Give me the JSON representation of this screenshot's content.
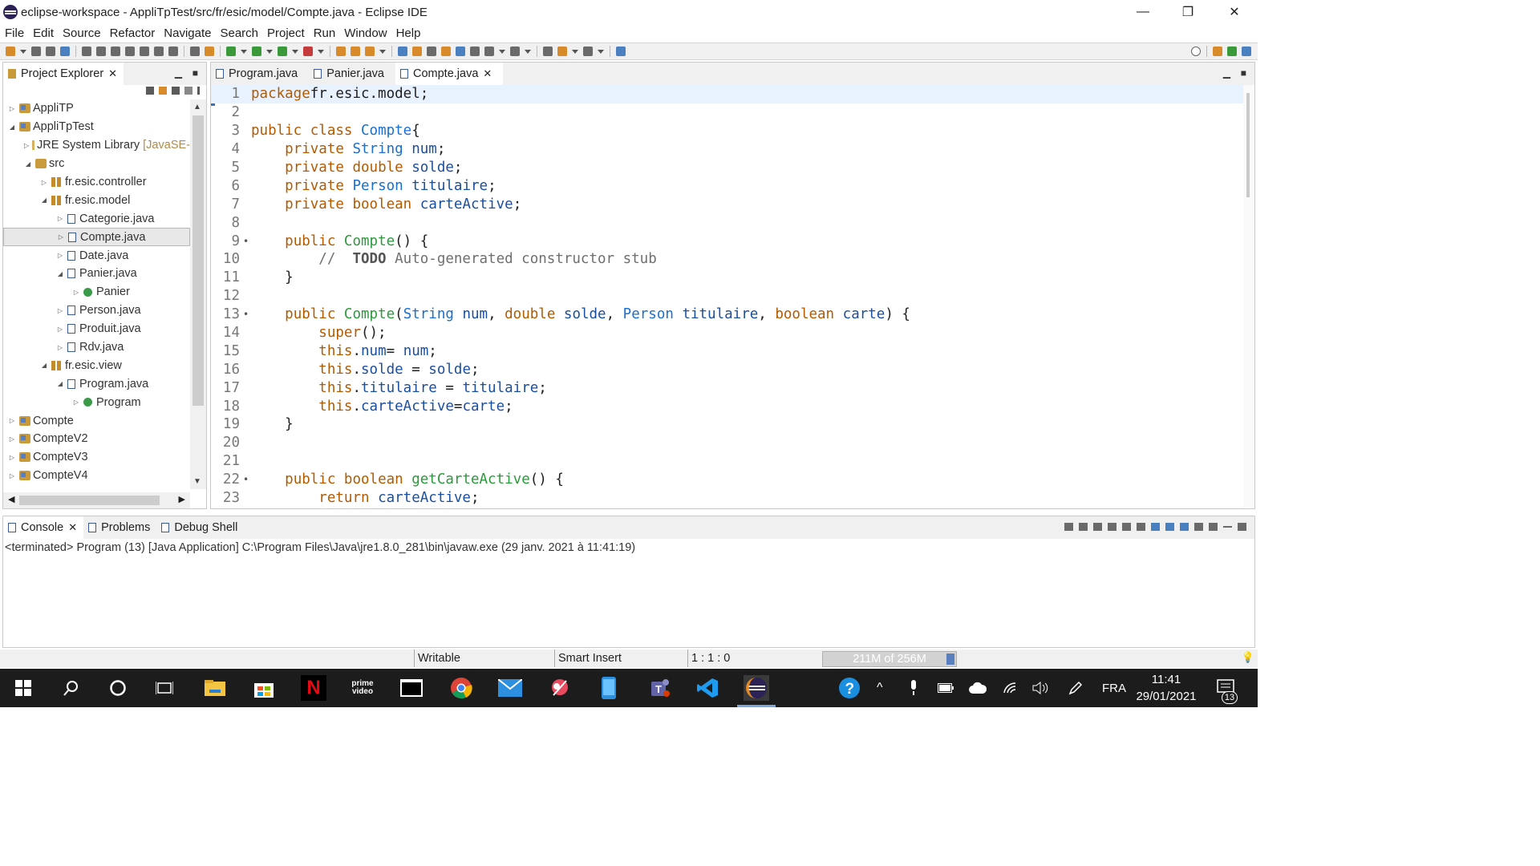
{
  "window": {
    "title": "eclipse-workspace - AppliTpTest/src/fr/esic/model/Compte.java - Eclipse IDE",
    "minimize": "—",
    "restore": "❐",
    "close": "✕"
  },
  "menu": [
    "File",
    "Edit",
    "Source",
    "Refactor",
    "Navigate",
    "Search",
    "Project",
    "Run",
    "Window",
    "Help"
  ],
  "explorer": {
    "tab_label": "Project Explorer",
    "tree": [
      {
        "label": "AppliTP",
        "icon": "project-icon",
        "indent": 0,
        "twisty": "▷"
      },
      {
        "label": "AppliTpTest",
        "icon": "project-icon",
        "indent": 0,
        "twisty": "◢"
      },
      {
        "label": "JRE System Library",
        "suffix": "[JavaSE-",
        "icon": "library-icon",
        "indent": 1,
        "twisty": "▷"
      },
      {
        "label": "src",
        "icon": "source-folder-icon",
        "indent": 1,
        "twisty": "◢"
      },
      {
        "label": "fr.esic.controller",
        "icon": "package-icon",
        "indent": 2,
        "twisty": "▷"
      },
      {
        "label": "fr.esic.model",
        "icon": "package-icon",
        "indent": 2,
        "twisty": "◢"
      },
      {
        "label": "Categorie.java",
        "icon": "java-file-icon",
        "indent": 3,
        "twisty": "▷"
      },
      {
        "label": "Compte.java",
        "icon": "java-file-icon",
        "indent": 3,
        "twisty": "▷",
        "selected": true
      },
      {
        "label": "Date.java",
        "icon": "java-file-icon",
        "indent": 3,
        "twisty": "▷"
      },
      {
        "label": "Panier.java",
        "icon": "java-file-icon",
        "indent": 3,
        "twisty": "◢"
      },
      {
        "label": "Panier",
        "icon": "class-icon",
        "indent": 4,
        "twisty": "▷"
      },
      {
        "label": "Person.java",
        "icon": "java-file-icon",
        "indent": 3,
        "twisty": "▷"
      },
      {
        "label": "Produit.java",
        "icon": "java-file-icon",
        "indent": 3,
        "twisty": "▷"
      },
      {
        "label": "Rdv.java",
        "icon": "java-file-icon",
        "indent": 3,
        "twisty": "▷"
      },
      {
        "label": "fr.esic.view",
        "icon": "package-icon",
        "indent": 2,
        "twisty": "◢"
      },
      {
        "label": "Program.java",
        "icon": "java-file-icon",
        "indent": 3,
        "twisty": "◢"
      },
      {
        "label": "Program",
        "icon": "class-icon",
        "indent": 4,
        "twisty": "▷"
      },
      {
        "label": "Compte",
        "icon": "project-icon",
        "indent": 0,
        "twisty": "▷"
      },
      {
        "label": "CompteV2",
        "icon": "project-icon",
        "indent": 0,
        "twisty": "▷"
      },
      {
        "label": "CompteV3",
        "icon": "project-icon",
        "indent": 0,
        "twisty": "▷"
      },
      {
        "label": "CompteV4",
        "icon": "project-icon",
        "indent": 0,
        "twisty": "▷"
      }
    ]
  },
  "editor": {
    "tabs": [
      {
        "label": "Program.java",
        "active": false
      },
      {
        "label": "Panier.java",
        "active": false
      },
      {
        "label": "Compte.java",
        "active": true
      }
    ],
    "lines": [
      {
        "n": "1",
        "tokens": [
          [
            "kw",
            "package"
          ],
          [
            "",
            "fr.esic.model;"
          ]
        ],
        "current": true
      },
      {
        "n": "2",
        "tokens": []
      },
      {
        "n": "3",
        "tokens": [
          [
            "kw",
            "public"
          ],
          [
            "kw",
            "class"
          ],
          [
            "ty",
            "Compte"
          ],
          [
            "",
            "{"
          ]
        ]
      },
      {
        "n": "4",
        "tokens": [
          [
            "",
            "    "
          ],
          [
            "kw",
            "private"
          ],
          [
            "ty",
            "String"
          ],
          [
            "va",
            "num"
          ],
          [
            "",
            ";"
          ]
        ]
      },
      {
        "n": "5",
        "tokens": [
          [
            "",
            "    "
          ],
          [
            "kw",
            "private"
          ],
          [
            "kw",
            "double"
          ],
          [
            "va",
            "solde"
          ],
          [
            "",
            ";"
          ]
        ]
      },
      {
        "n": "6",
        "tokens": [
          [
            "",
            "    "
          ],
          [
            "kw",
            "private"
          ],
          [
            "ty",
            "Person"
          ],
          [
            "va",
            "titulaire"
          ],
          [
            "",
            ";"
          ]
        ]
      },
      {
        "n": "7",
        "tokens": [
          [
            "",
            "    "
          ],
          [
            "kw",
            "private"
          ],
          [
            "kw",
            "boolean"
          ],
          [
            "va",
            "carteActive"
          ],
          [
            "",
            ";"
          ]
        ]
      },
      {
        "n": "8",
        "tokens": []
      },
      {
        "n": "9",
        "fold": true,
        "tokens": [
          [
            "",
            "    "
          ],
          [
            "kw",
            "public"
          ],
          [
            "fn",
            "Compte"
          ],
          [
            "",
            "() {"
          ]
        ]
      },
      {
        "n": "10",
        "task": true,
        "tokens": [
          [
            "",
            "        "
          ],
          [
            "cm",
            "// "
          ],
          [
            "td",
            "TODO"
          ],
          [
            "cm",
            " Auto-generated constructor stub"
          ]
        ]
      },
      {
        "n": "11",
        "tokens": [
          [
            "",
            "    }"
          ]
        ]
      },
      {
        "n": "12",
        "tokens": []
      },
      {
        "n": "13",
        "fold": true,
        "tokens": [
          [
            "",
            "    "
          ],
          [
            "kw",
            "public"
          ],
          [
            "fn",
            "Compte"
          ],
          [
            "",
            "("
          ],
          [
            "ty",
            "String"
          ],
          [
            "va",
            "num"
          ],
          [
            "",
            ", "
          ],
          [
            "kw",
            "double"
          ],
          [
            "va",
            "solde"
          ],
          [
            "",
            ", "
          ],
          [
            "ty",
            "Person"
          ],
          [
            "va",
            "titulaire"
          ],
          [
            "",
            ", "
          ],
          [
            "kw",
            "boolean"
          ],
          [
            "va",
            "carte"
          ],
          [
            "",
            ") {"
          ]
        ]
      },
      {
        "n": "14",
        "tokens": [
          [
            "",
            "        "
          ],
          [
            "kw",
            "super"
          ],
          [
            "",
            "();"
          ]
        ]
      },
      {
        "n": "15",
        "tokens": [
          [
            "",
            "        "
          ],
          [
            "kw",
            "this"
          ],
          [
            "",
            "."
          ],
          [
            "va",
            "num"
          ],
          [
            "",
            "= "
          ],
          [
            "va",
            "num"
          ],
          [
            "",
            ";"
          ]
        ]
      },
      {
        "n": "16",
        "tokens": [
          [
            "",
            "        "
          ],
          [
            "kw",
            "this"
          ],
          [
            "",
            "."
          ],
          [
            "va",
            "solde"
          ],
          [
            "",
            " = "
          ],
          [
            "va",
            "solde"
          ],
          [
            "",
            ";"
          ]
        ]
      },
      {
        "n": "17",
        "tokens": [
          [
            "",
            "        "
          ],
          [
            "kw",
            "this"
          ],
          [
            "",
            "."
          ],
          [
            "va",
            "titulaire"
          ],
          [
            "",
            " = "
          ],
          [
            "va",
            "titulaire"
          ],
          [
            "",
            ";"
          ]
        ]
      },
      {
        "n": "18",
        "tokens": [
          [
            "",
            "        "
          ],
          [
            "kw",
            "this"
          ],
          [
            "",
            "."
          ],
          [
            "va",
            "carteActive"
          ],
          [
            "",
            "="
          ],
          [
            "va",
            "carte"
          ],
          [
            "",
            ";"
          ]
        ]
      },
      {
        "n": "19",
        "tokens": [
          [
            "",
            "    }"
          ]
        ]
      },
      {
        "n": "20",
        "tokens": []
      },
      {
        "n": "21",
        "tokens": []
      },
      {
        "n": "22",
        "fold": true,
        "tokens": [
          [
            "",
            "    "
          ],
          [
            "kw",
            "public"
          ],
          [
            "kw",
            "boolean"
          ],
          [
            "fn",
            "getCarteActive"
          ],
          [
            "",
            "() {"
          ]
        ]
      },
      {
        "n": "23",
        "tokens": [
          [
            "",
            "        "
          ],
          [
            "kw",
            "return"
          ],
          [
            "va",
            "carteActive"
          ],
          [
            "",
            ";"
          ]
        ]
      }
    ]
  },
  "console": {
    "tabs": [
      {
        "label": "Console",
        "active": true,
        "closable": true
      },
      {
        "label": "Problems",
        "active": false
      },
      {
        "label": "Debug Shell",
        "active": false
      }
    ],
    "header": "<terminated> Program (13) [Java Application] C:\\Program Files\\Java\\jre1.8.0_281\\bin\\javaw.exe (29 janv. 2021 à 11:41:19)"
  },
  "status": {
    "writable": "Writable",
    "insert_mode": "Smart Insert",
    "position": "1 : 1 : 0",
    "heap": "211M of 256M"
  },
  "taskbar": {
    "apps": [
      "windows-start-icon",
      "search-icon",
      "cortana-icon",
      "task-view-icon",
      "file-explorer-icon",
      "store-icon",
      "netflix-icon",
      "prime-video-icon",
      "terminal-icon",
      "chrome-icon",
      "mail-icon",
      "snip-icon",
      "phone-icon",
      "teams-icon",
      "vscode-icon",
      "eclipse-icon"
    ],
    "prime_label": "prime video",
    "netflix_label": "N",
    "language": "FRA",
    "time": "11:41",
    "date": "29/01/2021",
    "notifications": "13"
  }
}
